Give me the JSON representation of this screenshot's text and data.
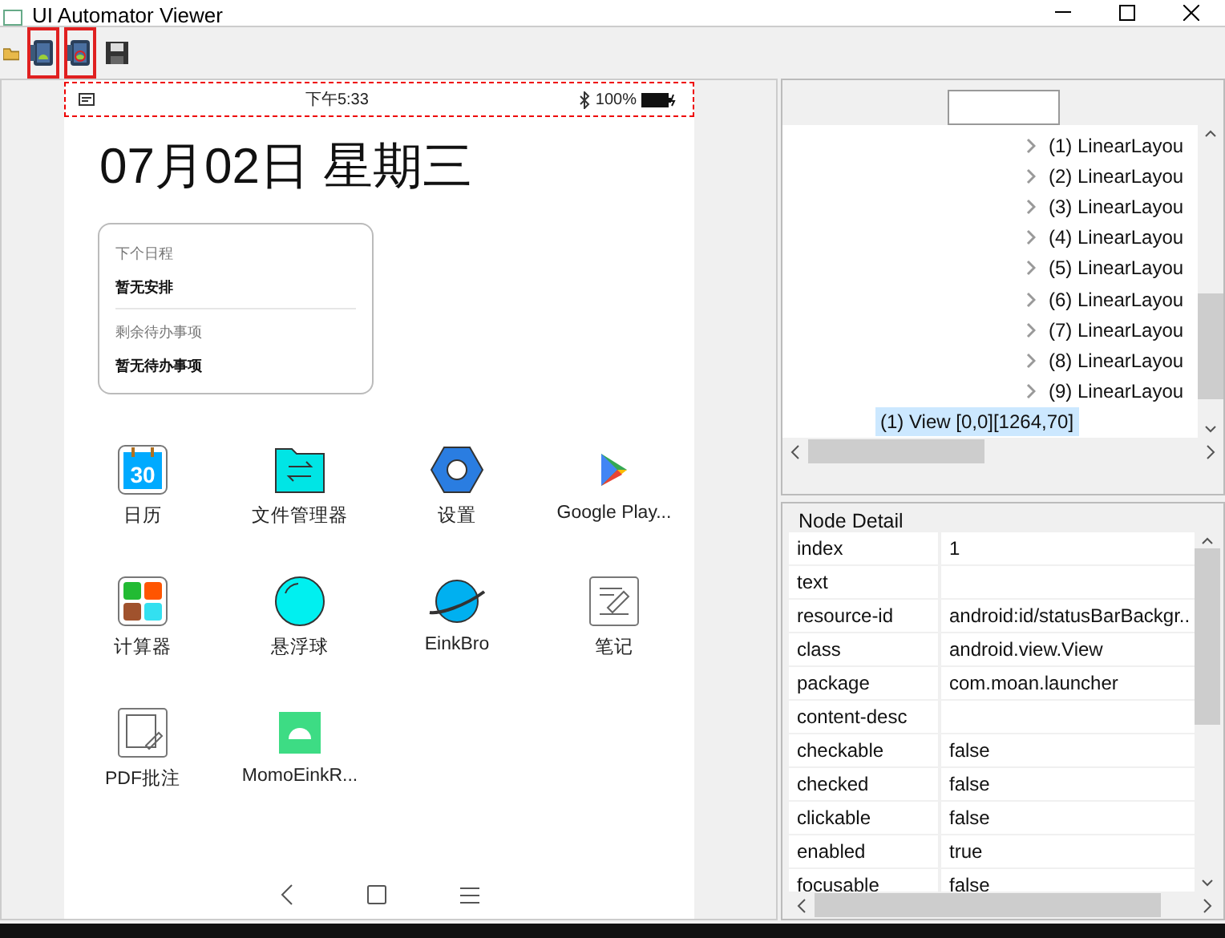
{
  "window": {
    "title": "UI Automator Viewer"
  },
  "toolbar": [
    {
      "kind": "open",
      "highlighted": false
    },
    {
      "kind": "screenshot",
      "highlighted": true
    },
    {
      "kind": "screenshot_compressed",
      "highlighted": true
    },
    {
      "kind": "save",
      "highlighted": false
    }
  ],
  "device": {
    "status_bar": {
      "time": "下午5:33",
      "battery": "100%",
      "selected": true
    },
    "date": "07月02日 星期三",
    "card": [
      {
        "label": "下个日程",
        "value": "暂无安排"
      },
      {
        "label": "剩余待办事项",
        "value": "暂无待办事项"
      }
    ],
    "apps": [
      {
        "kind": "calendar",
        "label": "日历",
        "badge": "30"
      },
      {
        "kind": "files",
        "label": "文件管理器"
      },
      {
        "kind": "settings",
        "label": "设置"
      },
      {
        "kind": "play",
        "label": "Google Play..."
      },
      {
        "kind": "calculator",
        "label": "计算器"
      },
      {
        "kind": "ball",
        "label": "悬浮球"
      },
      {
        "kind": "browser",
        "label": "EinkBro"
      },
      {
        "kind": "notes",
        "label": "笔记"
      },
      {
        "kind": "pdf",
        "label": "PDF批注"
      },
      {
        "kind": "android",
        "label": "MomoEinkR..."
      }
    ]
  },
  "tree": [
    {
      "label": "(1) LinearLayou",
      "expandable": true,
      "selected": false
    },
    {
      "label": "(2) LinearLayou",
      "expandable": true,
      "selected": false
    },
    {
      "label": "(3) LinearLayou",
      "expandable": true,
      "selected": false
    },
    {
      "label": "(4) LinearLayou",
      "expandable": true,
      "selected": false
    },
    {
      "label": "(5) LinearLayou",
      "expandable": true,
      "selected": false
    },
    {
      "label": "(6) LinearLayou",
      "expandable": true,
      "selected": false
    },
    {
      "label": "(7) LinearLayou",
      "expandable": true,
      "selected": false
    },
    {
      "label": "(8) LinearLayou",
      "expandable": true,
      "selected": false
    },
    {
      "label": "(9) LinearLayou",
      "expandable": true,
      "selected": false
    },
    {
      "label": "(1) View [0,0][1264,70]",
      "expandable": false,
      "selected": true
    }
  ],
  "node_detail": {
    "title": "Node Detail",
    "rows": [
      {
        "name": "index",
        "value": "1"
      },
      {
        "name": "text"
      },
      {
        "name": "resource-id",
        "value": "android:id/statusBarBackgr.."
      },
      {
        "name": "class",
        "value": "android.view.View"
      },
      {
        "name": "package",
        "value": "com.moan.launcher"
      },
      {
        "name": "content-desc"
      },
      {
        "name": "checkable",
        "value": "false"
      },
      {
        "name": "checked",
        "value": "false"
      },
      {
        "name": "clickable",
        "value": "false"
      },
      {
        "name": "enabled",
        "value": "true"
      },
      {
        "name": "focusable",
        "value": "false"
      }
    ]
  }
}
